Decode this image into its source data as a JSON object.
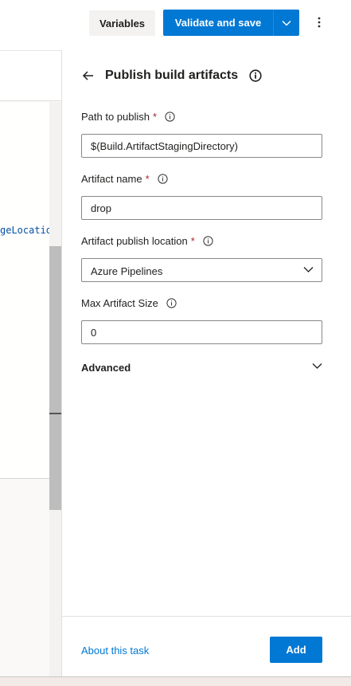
{
  "toolbar": {
    "variables_label": "Variables",
    "validate_label": "Validate and save"
  },
  "editor": {
    "code_snippet": "geLocation="
  },
  "panel": {
    "title": "Publish build artifacts",
    "fields": [
      {
        "label": "Path to publish",
        "required": "*",
        "value": "$(Build.ArtifactStagingDirectory)"
      },
      {
        "label": "Artifact name",
        "required": "*",
        "value": "drop"
      },
      {
        "label": "Artifact publish location",
        "required": "*",
        "value": "Azure Pipelines"
      },
      {
        "label": "Max Artifact Size",
        "value": "0"
      }
    ],
    "advanced_label": "Advanced",
    "about_link": "About this task",
    "add_label": "Add"
  },
  "colors": {
    "accent": "#0078d4",
    "required": "#a4262c"
  }
}
